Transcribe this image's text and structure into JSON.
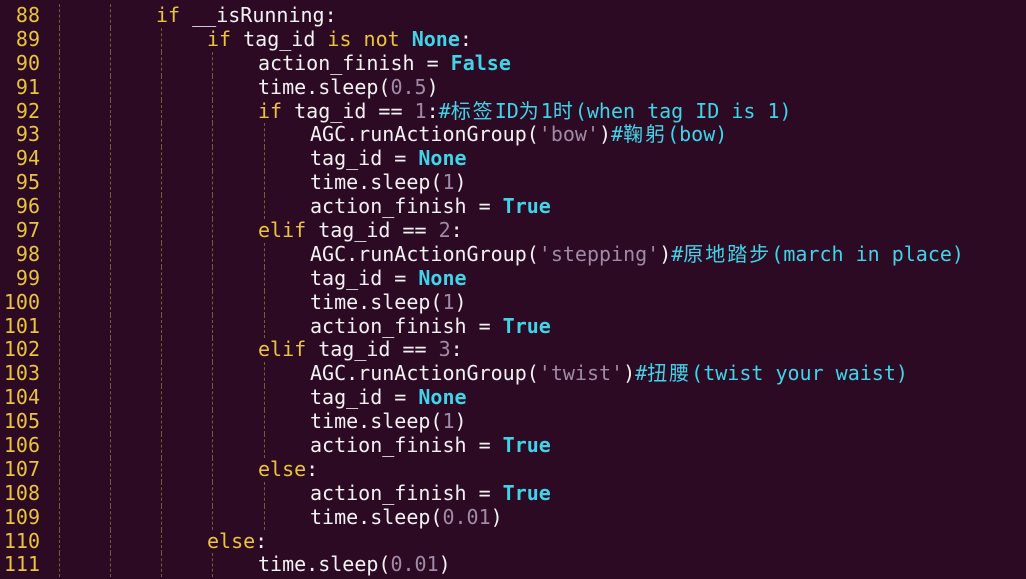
{
  "lines": [
    {
      "n": "88",
      "indent": 2,
      "tokens": [
        [
          "kw",
          "if"
        ],
        [
          "t",
          " __isRunning:"
        ]
      ]
    },
    {
      "n": "89",
      "indent": 3,
      "tokens": [
        [
          "kw",
          "if"
        ],
        [
          "t",
          " tag_id "
        ],
        [
          "kw",
          "is not"
        ],
        [
          "t",
          " "
        ],
        [
          "const",
          "None"
        ],
        [
          "t",
          ":"
        ]
      ]
    },
    {
      "n": "90",
      "indent": 4,
      "tokens": [
        [
          "t",
          "action_finish = "
        ],
        [
          "const",
          "False"
        ]
      ]
    },
    {
      "n": "91",
      "indent": 4,
      "tokens": [
        [
          "t",
          "time.sleep("
        ],
        [
          "num",
          "0.5"
        ],
        [
          "t",
          ")"
        ]
      ]
    },
    {
      "n": "92",
      "indent": 4,
      "tokens": [
        [
          "kw",
          "if"
        ],
        [
          "t",
          " tag_id == "
        ],
        [
          "num",
          "1"
        ],
        [
          "t",
          ":"
        ],
        [
          "cmt",
          "#标签ID为1时(when tag ID is 1)"
        ]
      ]
    },
    {
      "n": "93",
      "indent": 5,
      "tokens": [
        [
          "t",
          "AGC.runActionGroup("
        ],
        [
          "str",
          "'bow'"
        ],
        [
          "t",
          ")"
        ],
        [
          "cmt",
          "#鞠躬(bow)"
        ]
      ]
    },
    {
      "n": "94",
      "indent": 5,
      "tokens": [
        [
          "t",
          "tag_id = "
        ],
        [
          "const",
          "None"
        ]
      ]
    },
    {
      "n": "95",
      "indent": 5,
      "tokens": [
        [
          "t",
          "time.sleep("
        ],
        [
          "num",
          "1"
        ],
        [
          "t",
          ")"
        ]
      ]
    },
    {
      "n": "96",
      "indent": 5,
      "tokens": [
        [
          "t",
          "action_finish = "
        ],
        [
          "const",
          "True"
        ]
      ]
    },
    {
      "n": "97",
      "indent": 4,
      "tokens": [
        [
          "kw",
          "elif"
        ],
        [
          "t",
          " tag_id == "
        ],
        [
          "num",
          "2"
        ],
        [
          "t",
          ":"
        ]
      ]
    },
    {
      "n": "98",
      "indent": 5,
      "tokens": [
        [
          "t",
          "AGC.runActionGroup("
        ],
        [
          "str",
          "'stepping'"
        ],
        [
          "t",
          ")"
        ],
        [
          "cmt",
          "#原地踏步(march in place)"
        ]
      ]
    },
    {
      "n": "99",
      "indent": 5,
      "tokens": [
        [
          "t",
          "tag_id = "
        ],
        [
          "const",
          "None"
        ]
      ]
    },
    {
      "n": "100",
      "indent": 5,
      "tokens": [
        [
          "t",
          "time.sleep("
        ],
        [
          "num",
          "1"
        ],
        [
          "t",
          ")"
        ]
      ]
    },
    {
      "n": "101",
      "indent": 5,
      "tokens": [
        [
          "t",
          "action_finish = "
        ],
        [
          "const",
          "True"
        ]
      ]
    },
    {
      "n": "102",
      "indent": 4,
      "tokens": [
        [
          "kw",
          "elif"
        ],
        [
          "t",
          " tag_id == "
        ],
        [
          "num",
          "3"
        ],
        [
          "t",
          ":"
        ]
      ]
    },
    {
      "n": "103",
      "indent": 5,
      "tokens": [
        [
          "t",
          "AGC.runActionGroup("
        ],
        [
          "str",
          "'twist'"
        ],
        [
          "t",
          ")"
        ],
        [
          "cmt",
          "#扭腰(twist your waist)"
        ]
      ]
    },
    {
      "n": "104",
      "indent": 5,
      "tokens": [
        [
          "t",
          "tag_id = "
        ],
        [
          "const",
          "None"
        ]
      ]
    },
    {
      "n": "105",
      "indent": 5,
      "tokens": [
        [
          "t",
          "time.sleep("
        ],
        [
          "num",
          "1"
        ],
        [
          "t",
          ")"
        ]
      ]
    },
    {
      "n": "106",
      "indent": 5,
      "tokens": [
        [
          "t",
          "action_finish = "
        ],
        [
          "const",
          "True"
        ]
      ]
    },
    {
      "n": "107",
      "indent": 4,
      "tokens": [
        [
          "kw",
          "else"
        ],
        [
          "t",
          ":"
        ]
      ]
    },
    {
      "n": "108",
      "indent": 5,
      "tokens": [
        [
          "t",
          "action_finish = "
        ],
        [
          "const",
          "True"
        ]
      ]
    },
    {
      "n": "109",
      "indent": 5,
      "tokens": [
        [
          "t",
          "time.sleep("
        ],
        [
          "num",
          "0.01"
        ],
        [
          "t",
          ")"
        ]
      ]
    },
    {
      "n": "110",
      "indent": 3,
      "tokens": [
        [
          "kw",
          "else"
        ],
        [
          "t",
          ":"
        ]
      ]
    },
    {
      "n": "111",
      "indent": 4,
      "tokens": [
        [
          "t",
          "time.sleep("
        ],
        [
          "num",
          "0.01"
        ],
        [
          "t",
          ")"
        ]
      ]
    }
  ],
  "colors": {
    "background": "#2d0a24",
    "line_number": "#e8c53a",
    "keyword": "#e8c53a",
    "constant": "#3fd4e8",
    "number": "#a08aa6",
    "comment": "#3fd4e8",
    "text": "#f2f2f2"
  }
}
